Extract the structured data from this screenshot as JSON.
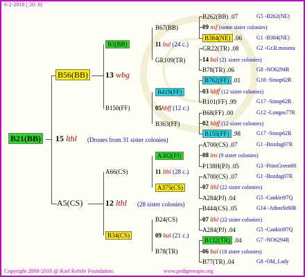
{
  "header": {
    "date": "6-2-2018 ( 20: 8)"
  },
  "footer": {
    "copyright": "Copyright 2008-2018 @ Karl Kehrle Foundation.",
    "website": "www.pedigreeapis.org"
  },
  "tree": {
    "root": {
      "id": "B21(BB)",
      "num": "15",
      "code": "lthl",
      "note": "(Drones from 31 sister colonies)"
    },
    "p1": {
      "id": "B56(BB)",
      "num": "13",
      "code": "wbg"
    },
    "p2": {
      "id": "A5(CS)",
      "num": "12",
      "code": "lthl",
      "note": "(28 sister colonies)"
    },
    "g1": {
      "id": "B3(BB)",
      "num": "11",
      "code": "bal",
      "note": "(24 c.)"
    },
    "g2": {
      "id": "B150(FF)",
      "num": "05",
      "code": "hbff",
      "note": "(12 c.)"
    },
    "g3": {
      "id": "A66(CS)",
      "num": "11",
      "code": "lthl",
      "note": "(28 c.)"
    },
    "g4": {
      "id": "B34(CS)",
      "num": "09",
      "code": "bal",
      "note": "(21 c.)"
    },
    "gg1": {
      "id": "B67(BB)"
    },
    "gg2": {
      "id": "GR109(TR)"
    },
    "gg3": {
      "id": "B419(FF)"
    },
    "gg4": {
      "id": "B363(FF)"
    },
    "gg5": {
      "id": "A302(PJ)"
    },
    "gg6": {
      "id": "A375(CS)"
    },
    "gg7": {
      "id": "B24(CS)"
    },
    "gg8": {
      "id": "B78(TR)"
    },
    "r": [
      {
        "a": "B262(BB)",
        "b": ".07",
        "c": "G5 -B262(NE)"
      },
      {
        "a": "09",
        "code": "nsf",
        "note": "(some sister colonies)"
      },
      {
        "a": "B384(NE)",
        "b": ".06",
        "c": "G1 -B384(NE)"
      },
      {
        "a": "GR22(TR)",
        "b": ".08",
        "c": "G2 -Gr.R.mounta"
      },
      {
        "a": "14",
        "code": "bal",
        "note": "(21 sister colonies)"
      },
      {
        "a": "B78(TR)",
        "b": ".06",
        "c": "G8 -NO6294R"
      },
      {
        "a": "B762(FF)",
        "b": ".01",
        "c": "G18 -Sinop62R"
      },
      {
        "a": "03",
        "code": "hbff",
        "note": "(12 sister colonies)"
      },
      {
        "a": "B101(FF)",
        "b": ".99",
        "c": "G17 -Sinop62R"
      },
      {
        "a": "B68(FF)",
        "b": ".00",
        "c": "G12 -Longos77R"
      },
      {
        "a": "02",
        "code": "hbff",
        "note": "(12 sister colonies)"
      },
      {
        "a": "B155(FF)",
        "b": ".98",
        "c": "G17 -Sinop62R"
      },
      {
        "a": "A700(CS)",
        "b": ".07",
        "c": "G1 -Bozdag07R"
      },
      {
        "a": "08",
        "code": "ins",
        "note": "(9 sister colonies)"
      },
      {
        "a": "P138H(PJ)",
        "b": ".05",
        "c": "G3 -PrimGreen00"
      },
      {
        "a": "A700(CS)",
        "b": ".07",
        "c": "G1 -Bozdag07R"
      },
      {
        "a": "07",
        "code": "lthl",
        "note": "(22 sister colonies)"
      },
      {
        "a": "A284(PJ)",
        "b": ".04",
        "c": "G5 -Cankiri97Q"
      },
      {
        "a": "B444(CS)",
        "b": ".05",
        "c": "G14 -AthosSt80R"
      },
      {
        "a": "07",
        "code": "lthl",
        "note": "(22 sister colonies)"
      },
      {
        "a": "A284(PJ)",
        "b": ".04",
        "c": "G5 -Cankiri97Q"
      },
      {
        "a": "B132(TR)",
        "b": ".04",
        "c": "G7 -NO6294R"
      },
      {
        "a": "06",
        "code": "bal",
        "note": "(18 sister colonies)"
      },
      {
        "a": "B77(TR)",
        "b": ".04",
        "c": "G8 -Old_Lady"
      }
    ]
  },
  "colors": {
    "frame": "#cc00cc",
    "green": "#22dd22",
    "yellow": "#ffee00",
    "cyan": "#22ddee",
    "blue": "#0000cc",
    "red": "#cc0000"
  }
}
